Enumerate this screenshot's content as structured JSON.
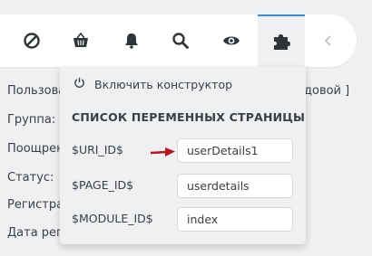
{
  "toolbar": {
    "buttons": [
      {
        "name": "block-icon"
      },
      {
        "name": "basket-icon"
      },
      {
        "name": "bell-icon"
      },
      {
        "name": "search-icon"
      },
      {
        "name": "eye-icon"
      },
      {
        "name": "puzzle-icon",
        "active": true
      },
      {
        "name": "chevron-left-icon"
      }
    ]
  },
  "background": {
    "labels": [
      "Пользова",
      "Группа:",
      "Поощрен",
      "Статус:",
      "Регистра",
      "Дата реги"
    ],
    "right_fragment": "довой ]"
  },
  "panel": {
    "toggle_label": "Включить конструктор",
    "title": "СПИСОК ПЕРЕМЕННЫХ СТРАНИЦЫ",
    "variables": [
      {
        "name": "$URI_ID$",
        "value": "userDetails1"
      },
      {
        "name": "$PAGE_ID$",
        "value": "userdetails"
      },
      {
        "name": "$MODULE_ID$",
        "value": "index"
      }
    ]
  },
  "colors": {
    "accent": "#3d8bdc",
    "arrow": "#c0141c",
    "icon": "#2f3438"
  }
}
